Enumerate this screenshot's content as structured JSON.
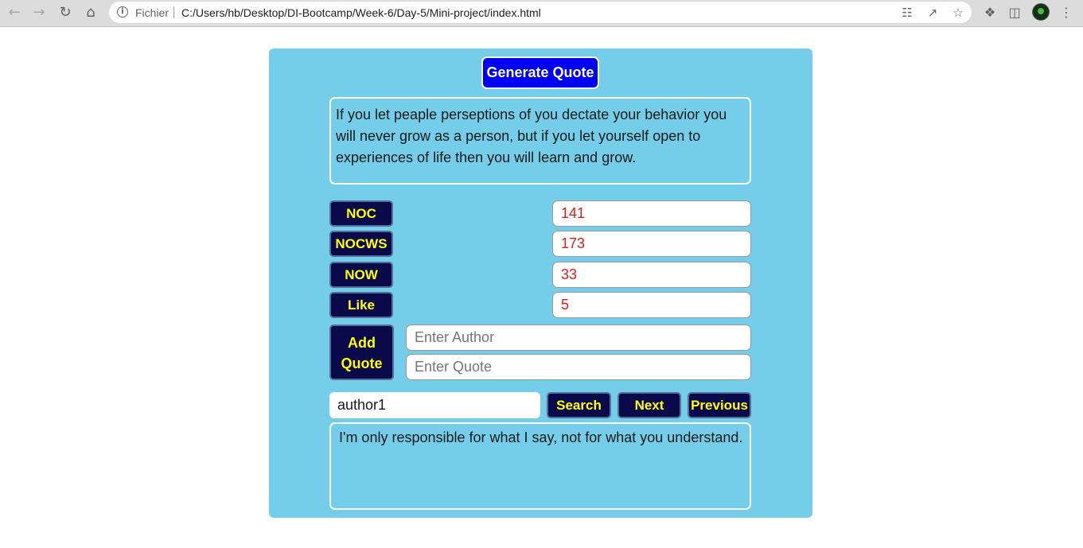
{
  "browser": {
    "scheme_label": "Fichier",
    "url": "C:/Users/hb/Desktop/DI-Bootcamp/Week-6/Day-5/Mini-project/index.html",
    "icons": [
      "back-icon",
      "forward-icon",
      "reload-icon",
      "home-icon",
      "info-icon",
      "translate-icon",
      "share-icon",
      "star-icon",
      "extensions-icon",
      "side-panel-icon",
      "profile-avatar",
      "menu-icon"
    ]
  },
  "app": {
    "generate_label": "Generate Quote",
    "quote_text": "If you let peaple perseptions of you dectate your behavior you will never grow as a person, but if you let yourself open to experiences of life then you will learn and grow.",
    "stats": [
      {
        "label": "NOC",
        "value": "141"
      },
      {
        "label": "NOCWS",
        "value": "173"
      },
      {
        "label": "NOW",
        "value": "33"
      },
      {
        "label": "Like",
        "value": "5"
      }
    ],
    "add": {
      "label_line1": "Add",
      "label_line2": "Quote",
      "author_placeholder": "Enter Author",
      "quote_placeholder": "Enter Quote"
    },
    "search": {
      "value": "author1",
      "search_label": "Search",
      "next_label": "Next",
      "previous_label": "Previous"
    },
    "result_text": "I'm only responsible for what I say, not for what you understand."
  },
  "colors": {
    "card_bg": "#74cde9",
    "generate_btn": "#0000f5",
    "action_btn_bg": "#0a0a4a",
    "action_btn_text": "#ffff00",
    "stat_value_text": "#d42020"
  }
}
